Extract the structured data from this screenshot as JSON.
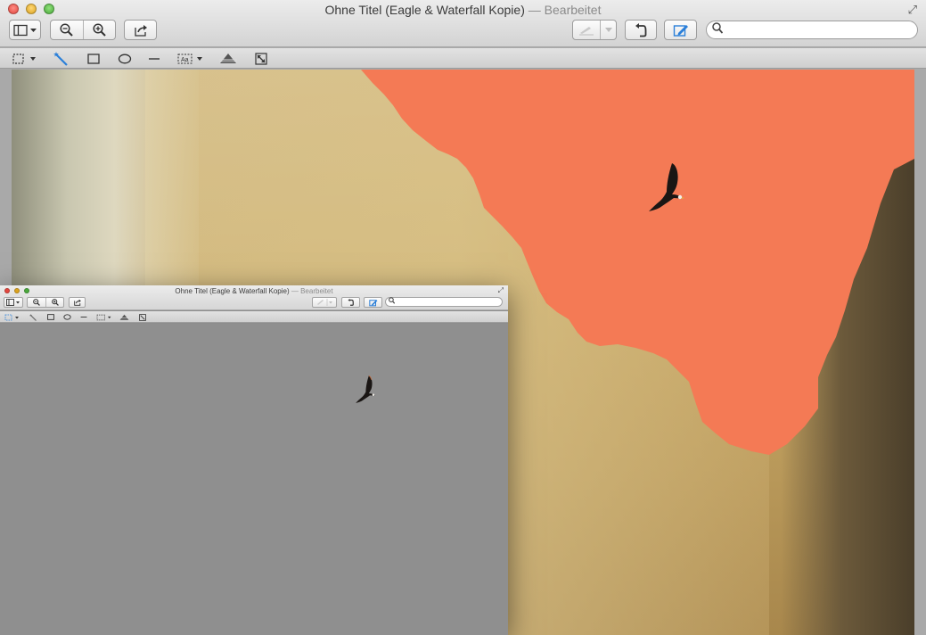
{
  "window": {
    "title": "Ohne Titel (Eagle & Waterfall Kopie)",
    "subtitle": "— Bearbeitet"
  },
  "toolbar": {
    "sidebar_icon": "sidebar-icon",
    "zoom_out_icon": "zoom-out-icon",
    "zoom_in_icon": "zoom-in-icon",
    "share_icon": "share-icon",
    "signature_icon": "signature-icon",
    "rotate_icon": "rotate-icon",
    "markup_icon": "markup-pen-icon",
    "search_placeholder": ""
  },
  "markup_tools": [
    "rect-selection-icon",
    "instant-alpha-icon",
    "rectangle-shape-icon",
    "oval-shape-icon",
    "line-shape-icon",
    "text-tool-icon",
    "adjust-color-icon",
    "adjust-size-icon"
  ],
  "window2": {
    "title": "Ohne Titel (Eagle & Waterfall Kopie)",
    "subtitle": "— Bearbeitet",
    "search_placeholder": ""
  },
  "colors": {
    "selection_overlay": "#f47a55",
    "toolbar_accent": "#2a7fd9"
  }
}
